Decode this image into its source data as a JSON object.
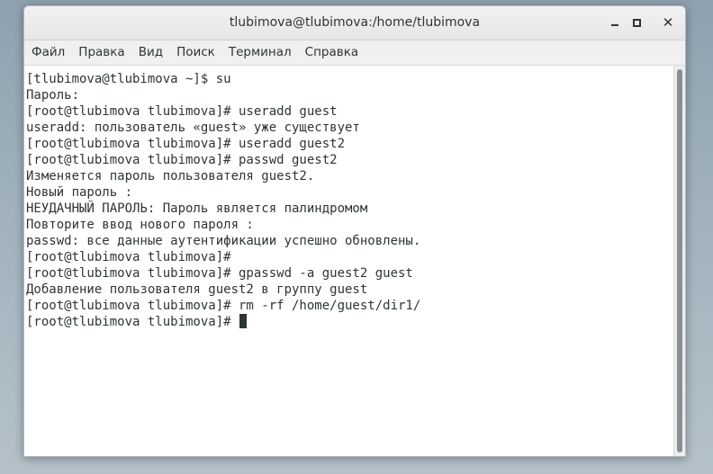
{
  "window": {
    "title": "tlubimova@tlubimova:/home/tlubimova",
    "controls": {
      "minimize": "minimize-icon",
      "maximize": "maximize-icon",
      "close": "close-icon",
      "close_glyph": "✕"
    }
  },
  "menu": {
    "items": [
      "Файл",
      "Правка",
      "Вид",
      "Поиск",
      "Терминал",
      "Справка"
    ]
  },
  "terminal": {
    "lines": [
      "[tlubimova@tlubimova ~]$ su",
      "Пароль:",
      "[root@tlubimova tlubimova]# useradd guest",
      "useradd: пользователь «guest» уже существует",
      "[root@tlubimova tlubimova]# useradd guest2",
      "[root@tlubimova tlubimova]# passwd guest2",
      "Изменяется пароль пользователя guest2.",
      "Новый пароль :",
      "НЕУДАЧНЫЙ ПАРОЛЬ: Пароль является палиндромом",
      "Повторите ввод нового пароля :",
      "passwd: все данные аутентификации успешно обновлены.",
      "[root@tlubimova tlubimova]#",
      "[root@tlubimova tlubimova]# gpasswd -a guest2 guest",
      "Добавление пользователя guest2 в группу guest",
      "[root@tlubimova tlubimova]# rm -rf /home/guest/dir1/",
      "[root@tlubimova tlubimova]# "
    ]
  },
  "colors": {
    "text": "#2e3436",
    "background": "#ffffff",
    "scrollbar_thumb": "#8b8e8f"
  }
}
